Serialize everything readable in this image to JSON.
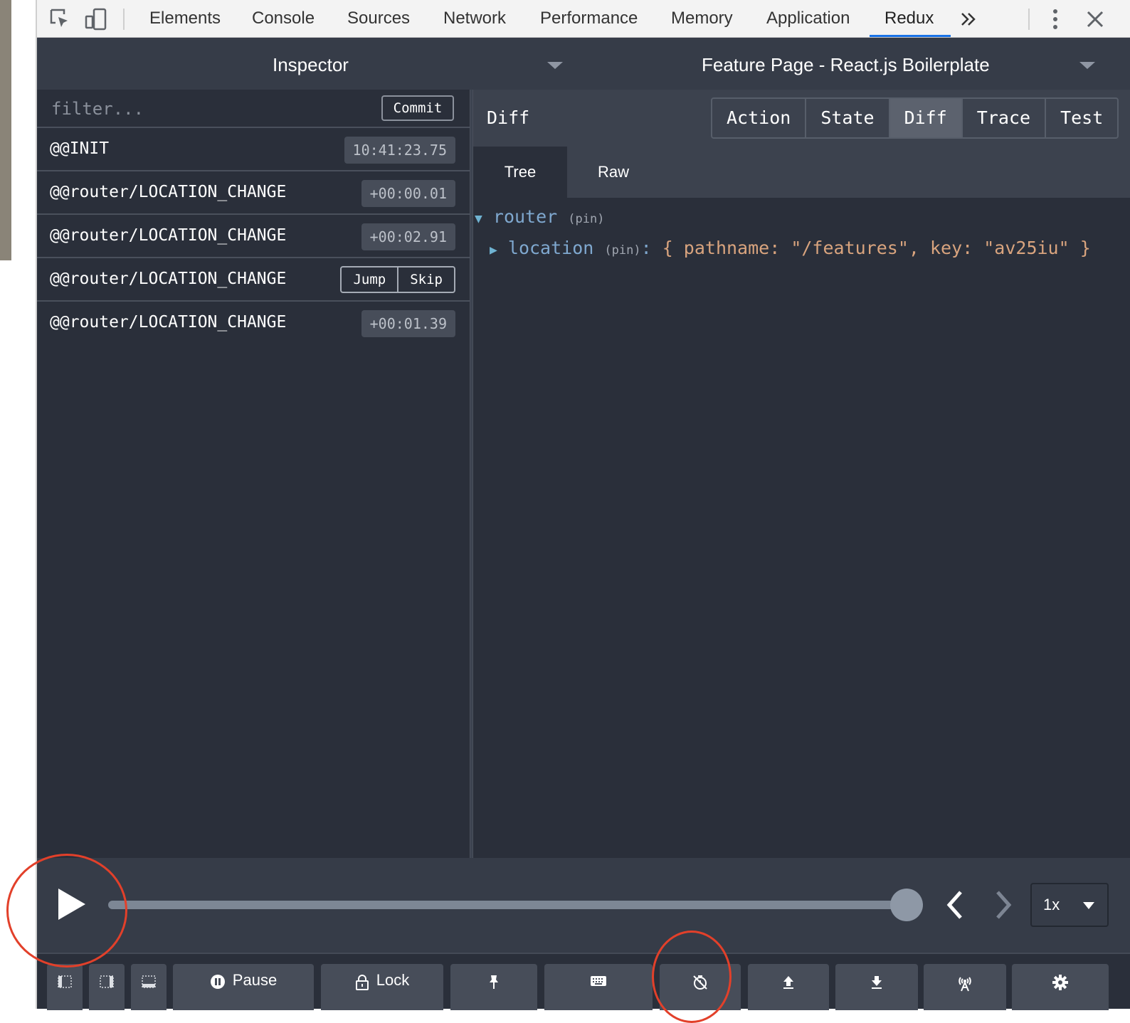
{
  "devtools": {
    "tabs": [
      "Elements",
      "Console",
      "Sources",
      "Network",
      "Performance",
      "Memory",
      "Application",
      "Redux"
    ],
    "active_tab": "Redux",
    "more_tabs_icon": "double-chevron-right-icon",
    "menu_icon": "kebab-menu-icon",
    "close_icon": "close-icon",
    "accent_color": "#1a73e8"
  },
  "redux": {
    "monitor_select": "Inspector",
    "instance_select": "Feature Page - React.js Boilerplate",
    "filter_placeholder": "filter...",
    "commit_label": "Commit",
    "actions": [
      {
        "name": "@@INIT",
        "time": "10:41:23.75"
      },
      {
        "name": "@@router/LOCATION_CHANGE",
        "time": "+00:00.01"
      },
      {
        "name": "@@router/LOCATION_CHANGE",
        "time": "+00:02.91"
      },
      {
        "name": "@@router/LOCATION_CHANGE",
        "jump_label": "Jump",
        "skip_label": "Skip"
      },
      {
        "name": "@@router/LOCATION_CHANGE",
        "time": "+00:01.39"
      }
    ],
    "panel_title": "Diff",
    "mode_tabs": [
      "Action",
      "State",
      "Diff",
      "Trace",
      "Test"
    ],
    "active_mode": "Diff",
    "sub_tabs": [
      "Tree",
      "Raw"
    ],
    "active_sub_tab": "Tree",
    "tree": {
      "root_key": "router",
      "root_pin": "(pin)",
      "child_key": "location",
      "child_pin": "(pin)",
      "child_colon": ":",
      "child_value": "{ pathname: \"/features\", key: \"av25iu\" }"
    },
    "slider": {
      "position": 1.0,
      "speed": "1x"
    },
    "buttons": {
      "pause_label": "Pause",
      "lock_label": "Lock"
    },
    "annotation_color": "#e2402a"
  }
}
